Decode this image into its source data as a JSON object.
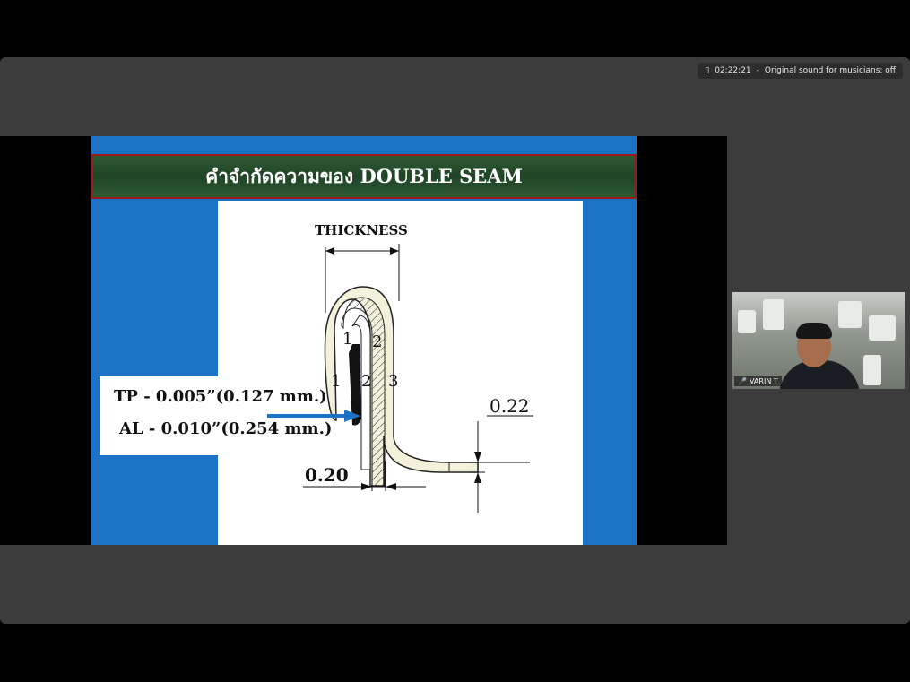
{
  "topbar": {
    "timer": "02:22:21",
    "separator": "-",
    "sound_label": "Original sound for musicians: off"
  },
  "slide": {
    "title": "คำจำกัดความของ DOUBLE SEAM",
    "thickness_label": "THICKNESS",
    "layer_labels": [
      "1",
      "2",
      "1",
      "2",
      "3"
    ],
    "dim_left": "0.20",
    "dim_right": "0.22",
    "spec": {
      "tp": "TP - 0.005”(0.127 mm.)",
      "al": "AL - 0.010”(0.254 mm.)"
    }
  },
  "participant": {
    "name": "VARIN T",
    "mic_icon": "mic-muted-icon"
  },
  "colors": {
    "slide_bg": "#1c73c5",
    "title_border": "#9b1b1b",
    "arrow": "#1c73c5"
  }
}
